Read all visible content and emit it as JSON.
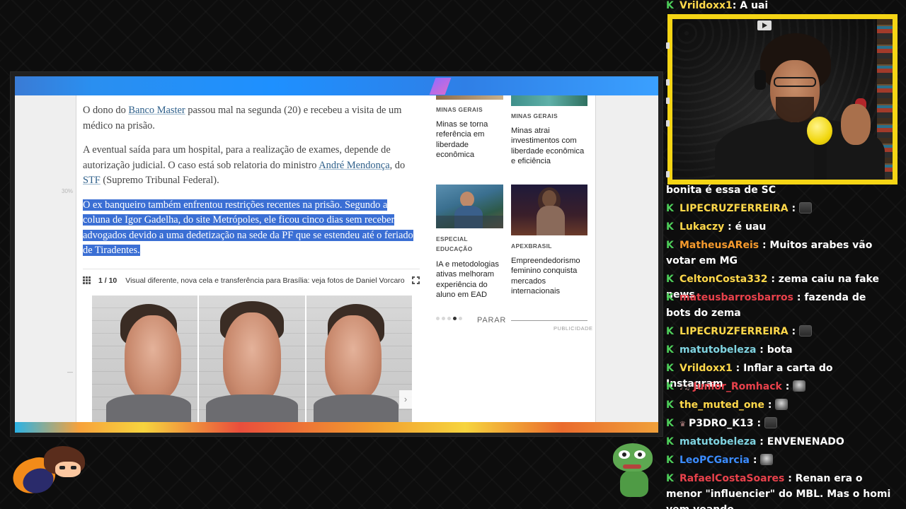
{
  "article": {
    "p1_pre": "O dono do ",
    "p1_link": "Banco Master",
    "p1_post": " passou mal na segunda (20) e recebeu a visita de um médico na prisão.",
    "p2_pre": "A eventual saída para um hospital, para a realização de exames, depende de autorização judicial. O caso está sob relatoria do ministro ",
    "p2_link1": "André Mendonça",
    "p2_mid": ", do ",
    "p2_link2": "STF",
    "p2_post": " (Supremo Tribunal Federal).",
    "p3_highlighted": "O ex banqueiro também enfrentou restrições recentes na prisão. Segundo a coluna de Igor Gadelha, do site Metrópoles, ele ficou cinco dias sem receber advogados devido a uma dedetização na sede da PF que se estendeu até o feriado de Tiradentes.",
    "side_percent": "30%",
    "left_dash": "—"
  },
  "gallery": {
    "counter": "1 / 10",
    "caption": "Visual diferente, nova cela e transferência para Brasília: veja fotos de Daniel Vorcaro",
    "next_arrow": "›"
  },
  "sidebar": {
    "items": [
      {
        "kicker": "MINAS GERAIS",
        "title": "Minas se torna referência em liberdade econômica"
      },
      {
        "kicker": "MINAS GERAIS",
        "title": "Minas atrai investimentos com liberdade econômica e eficiência"
      },
      {
        "kicker": "ESPECIAL EDUCAÇÃO",
        "title": "IA e metodologias ativas melhoram experiência do aluno em EAD"
      },
      {
        "kicker": "APEXBRASIL",
        "title": "Empreendedorismo feminino conquista mercados internacionais"
      }
    ],
    "parar": "PARAR",
    "publicidade": "PUBLICIDADE",
    "carousel_active_index": 3,
    "carousel_total": 5
  },
  "chat": {
    "messages": [
      {
        "user": "Vrildoxx1",
        "color": "#ffd84a",
        "text": " A uai",
        "sep": ":"
      },
      {
        "user": "",
        "color": "#ffffff",
        "text": "bonita é essa de SC",
        "sep": "",
        "continuation": true
      },
      {
        "user": "LIPECRUZFERREIRA",
        "color": "#ffd84a",
        "text": "",
        "sep": ":",
        "emote": "dark"
      },
      {
        "user": "Lukaczy",
        "color": "#ffd84a",
        "text": " é uau",
        "sep": ":"
      },
      {
        "user": "MatheusAReis",
        "color": "#f59a2d",
        "text": " Muitos arabes vão votar em MG",
        "sep": ":"
      },
      {
        "user": "CeltonCosta332",
        "color": "#ffd84a",
        "text": " zema caiu na fake news",
        "sep": ":"
      },
      {
        "user": "mateusbarrosbarros",
        "color": "#e8414b",
        "text": " fazenda de bots do zema",
        "sep": ":"
      },
      {
        "user": "LIPECRUZFERREIRA",
        "color": "#ffd84a",
        "text": "",
        "sep": ":",
        "emote": "dark"
      },
      {
        "user": "matutobeleza",
        "color": "#7fd3e0",
        "text": " bota",
        "sep": ":"
      },
      {
        "user": "Vrildoxx1",
        "color": "#ffd84a",
        "text": " Inflar a carta do Instagram",
        "sep": ":"
      },
      {
        "user": "Junior_Romhack",
        "color": "#e8414b",
        "text": "",
        "sep": ":",
        "emote": "light",
        "extra": "♪♫"
      },
      {
        "user": "the_muted_one",
        "color": "#ffd84a",
        "text": "",
        "sep": ":",
        "emote": "light"
      },
      {
        "user": "P3DRO_K13",
        "color": "#ffffff",
        "text": "",
        "sep": ":",
        "emote": "dark",
        "extra": "♛"
      },
      {
        "user": "matutobeleza",
        "color": "#7fd3e0",
        "text": " ENVENENADO",
        "sep": ":"
      },
      {
        "user": "LeoPCGarcia",
        "color": "#3b8cff",
        "text": "",
        "sep": ":",
        "emote": "light"
      },
      {
        "user": "RafaelCostaSoares",
        "color": "#e8414b",
        "text": " Renan era o menor \"influencier\" do MBL. Mas o homi vem voando",
        "sep": ":"
      }
    ],
    "badge_glyph": "K"
  },
  "webcam": {
    "frame_color": "#f5d515"
  }
}
